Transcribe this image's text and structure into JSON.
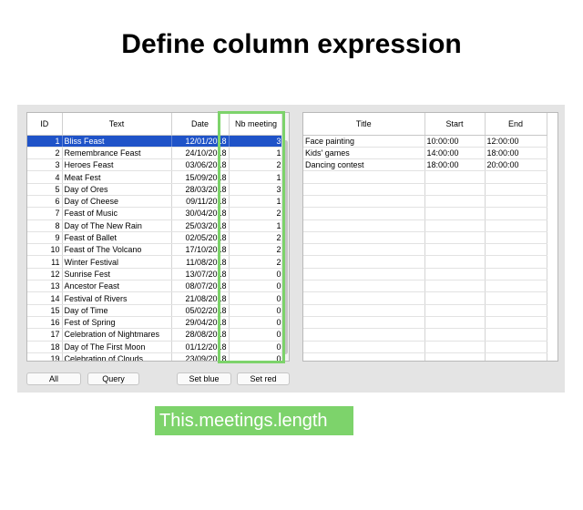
{
  "page_title": "Define column expression",
  "left_table": {
    "columns": [
      "ID",
      "Text",
      "Date",
      "Nb meeting"
    ],
    "rows": [
      {
        "id": "1",
        "text": "Bliss Feast",
        "date": "12/01/2018",
        "nb": "3"
      },
      {
        "id": "2",
        "text": "Remembrance Feast",
        "date": "24/10/2018",
        "nb": "1"
      },
      {
        "id": "3",
        "text": "Heroes Feast",
        "date": "03/06/2018",
        "nb": "2"
      },
      {
        "id": "4",
        "text": "Meat Fest",
        "date": "15/09/2018",
        "nb": "1"
      },
      {
        "id": "5",
        "text": "Day of Ores",
        "date": "28/03/2018",
        "nb": "3"
      },
      {
        "id": "6",
        "text": "Day of Cheese",
        "date": "09/11/2018",
        "nb": "1"
      },
      {
        "id": "7",
        "text": "Feast of Music",
        "date": "30/04/2018",
        "nb": "2"
      },
      {
        "id": "8",
        "text": "Day of The New Rain",
        "date": "25/03/2018",
        "nb": "1"
      },
      {
        "id": "9",
        "text": "Feast of Ballet",
        "date": "02/05/2018",
        "nb": "2"
      },
      {
        "id": "10",
        "text": "Feast of The Volcano",
        "date": "17/10/2018",
        "nb": "2"
      },
      {
        "id": "11",
        "text": "Winter Festival",
        "date": "11/08/2018",
        "nb": "2"
      },
      {
        "id": "12",
        "text": "Sunrise Fest",
        "date": "13/07/2018",
        "nb": "0"
      },
      {
        "id": "13",
        "text": "Ancestor Feast",
        "date": "08/07/2018",
        "nb": "0"
      },
      {
        "id": "14",
        "text": "Festival of Rivers",
        "date": "21/08/2018",
        "nb": "0"
      },
      {
        "id": "15",
        "text": "Day of Time",
        "date": "05/02/2018",
        "nb": "0"
      },
      {
        "id": "16",
        "text": "Fest of Spring",
        "date": "29/04/2018",
        "nb": "0"
      },
      {
        "id": "17",
        "text": "Celebration of Nightmares",
        "date": "28/08/2018",
        "nb": "0"
      },
      {
        "id": "18",
        "text": "Day of The First Moon",
        "date": "01/12/2018",
        "nb": "0"
      },
      {
        "id": "19",
        "text": "Celebration of Clouds",
        "date": "23/09/2018",
        "nb": "0"
      }
    ]
  },
  "right_table": {
    "columns": [
      "Title",
      "Start",
      "End"
    ],
    "rows": [
      {
        "title": "Face painting",
        "start": "10:00:00",
        "end": "12:00:00"
      },
      {
        "title": "Kids' games",
        "start": "14:00:00",
        "end": "18:00:00"
      },
      {
        "title": "Dancing contest",
        "start": "18:00:00",
        "end": "20:00:00"
      },
      {
        "title": "",
        "start": "",
        "end": ""
      },
      {
        "title": "",
        "start": "",
        "end": ""
      },
      {
        "title": "",
        "start": "",
        "end": ""
      },
      {
        "title": "",
        "start": "",
        "end": ""
      },
      {
        "title": "",
        "start": "",
        "end": ""
      },
      {
        "title": "",
        "start": "",
        "end": ""
      },
      {
        "title": "",
        "start": "",
        "end": ""
      },
      {
        "title": "",
        "start": "",
        "end": ""
      },
      {
        "title": "",
        "start": "",
        "end": ""
      },
      {
        "title": "",
        "start": "",
        "end": ""
      },
      {
        "title": "",
        "start": "",
        "end": ""
      },
      {
        "title": "",
        "start": "",
        "end": ""
      },
      {
        "title": "",
        "start": "",
        "end": ""
      },
      {
        "title": "",
        "start": "",
        "end": ""
      },
      {
        "title": "",
        "start": "",
        "end": ""
      },
      {
        "title": "",
        "start": "",
        "end": ""
      }
    ]
  },
  "buttons": {
    "all": "All",
    "query": "Query",
    "set_blue": "Set blue",
    "set_red": "Set red"
  },
  "expression_label": "This.meetings.length",
  "colors": {
    "selection": "#1f53c8",
    "highlight": "#7dd36b"
  }
}
